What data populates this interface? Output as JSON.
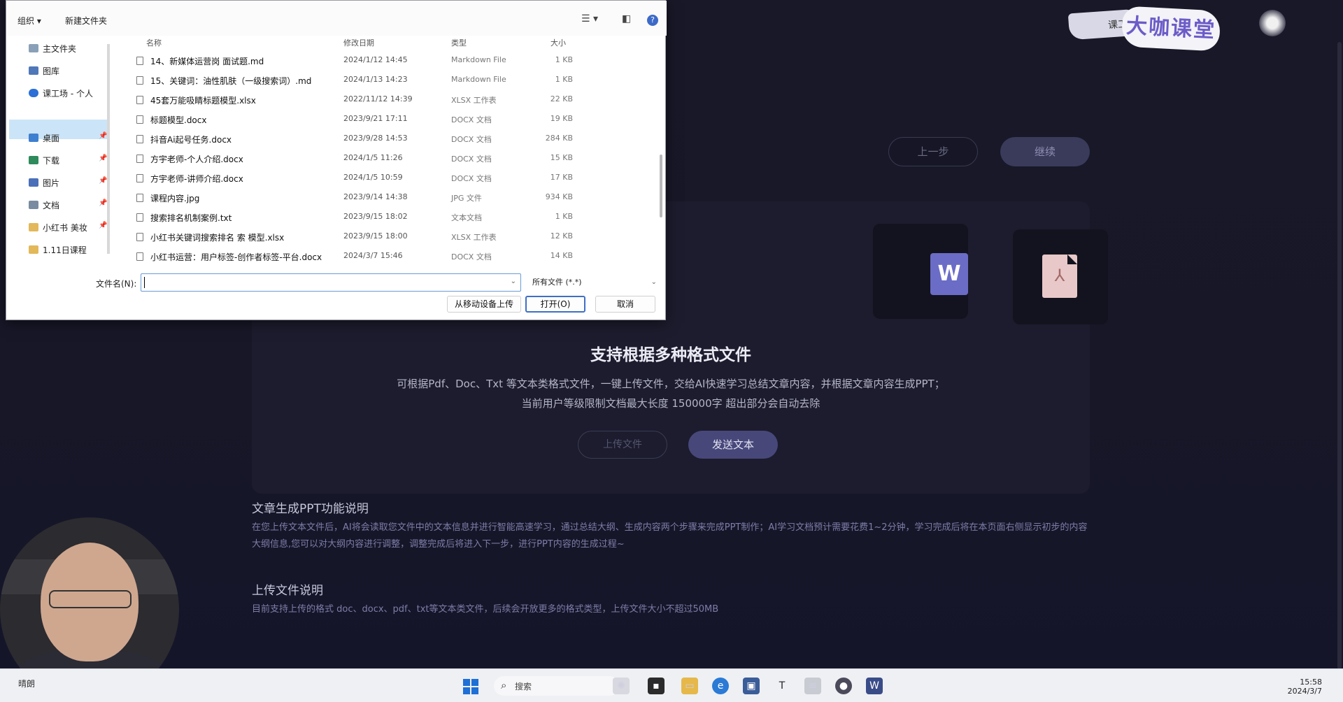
{
  "app": {
    "logo_small": "课工",
    "logo_main": "大咖课堂",
    "btn_prev": "上一步",
    "btn_next": "继续",
    "support_title": "支持根据多种格式文件",
    "support_desc_1": "可根据Pdf、Doc、Txt 等文本类格式文件，一键上传文件，交给AI快速学习总结文章内容，并根据文章内容生成PPT；",
    "support_desc_2": "当前用户等级限制文档最大长度  150000字 超出部分会自动去除",
    "btn_upload": "上传文件",
    "btn_send": "发送文本",
    "section1_title": "文章生成PPT功能说明",
    "section1_text": "在您上传文本文件后，AI将会读取您文件中的文本信息并进行智能高速学习，通过总结大纲、生成内容两个步骤来完成PPT制作；AI学习文档预计需要花费1~2分钟，学习完成后将在本页面右侧显示初步的内容大纲信息,您可以对大纲内容进行调整，调整完成后将进入下一步，进行PPT内容的生成过程~",
    "section2_title": "上传文件说明",
    "section2_text": "目前支持上传的格式 doc、docx、pdf、txt等文本类文件，后续会开放更多的格式类型，上传文件大小不超过50MB"
  },
  "dialog": {
    "toolbar": {
      "organize": "组织 ▾",
      "new_folder": "新建文件夹",
      "help": "?"
    },
    "nav": [
      {
        "label": "主文件夹",
        "pinned": false
      },
      {
        "label": "图库",
        "pinned": false
      },
      {
        "label": "课工场 - 个人",
        "pinned": false
      },
      {
        "label": "桌面",
        "pinned": true
      },
      {
        "label": "下载",
        "pinned": true
      },
      {
        "label": "图片",
        "pinned": true
      },
      {
        "label": "文档",
        "pinned": true
      },
      {
        "label": "小红书 美妆",
        "pinned": true
      },
      {
        "label": "1.11日课程",
        "pinned": false
      }
    ],
    "columns": {
      "name": "名称",
      "date": "修改日期",
      "type": "类型",
      "size": "大小"
    },
    "files": [
      {
        "name": "14、新媒体运营岗 面试题.md",
        "date": "2024/1/12 14:45",
        "type": "Markdown File",
        "size": "1 KB"
      },
      {
        "name": "15、关键词：油性肌肤（一级搜索词）.md",
        "date": "2024/1/13 14:23",
        "type": "Markdown File",
        "size": "1 KB"
      },
      {
        "name": "45套万能吸睛标题模型.xlsx",
        "date": "2022/11/12 14:39",
        "type": "XLSX 工作表",
        "size": "22 KB"
      },
      {
        "name": "标题模型.docx",
        "date": "2023/9/21 17:11",
        "type": "DOCX 文档",
        "size": "19 KB"
      },
      {
        "name": "抖音Ai起号任务.docx",
        "date": "2023/9/28 14:53",
        "type": "DOCX 文档",
        "size": "284 KB"
      },
      {
        "name": "方宇老师-个人介绍.docx",
        "date": "2024/1/5 11:26",
        "type": "DOCX 文档",
        "size": "15 KB"
      },
      {
        "name": "方宇老师-讲师介绍.docx",
        "date": "2024/1/5 10:59",
        "type": "DOCX 文档",
        "size": "17 KB"
      },
      {
        "name": "课程内容.jpg",
        "date": "2023/9/14 14:38",
        "type": "JPG 文件",
        "size": "934 KB"
      },
      {
        "name": "搜索排名机制案例.txt",
        "date": "2023/9/15 18:02",
        "type": "文本文档",
        "size": "1 KB"
      },
      {
        "name": "小红书关键词搜索排名 索 模型.xlsx",
        "date": "2023/9/15 18:00",
        "type": "XLSX 工作表",
        "size": "12 KB"
      },
      {
        "name": "小红书运营：用户标签-创作者标签-平台.docx",
        "date": "2024/3/7 15:46",
        "type": "DOCX 文档",
        "size": "14 KB"
      }
    ],
    "filename_label": "文件名(N):",
    "filename_value": "",
    "filetype": "所有文件 (*.*)",
    "btn_mobile": "从移动设备上传",
    "btn_open": "打开(O)",
    "btn_cancel": "取消"
  },
  "taskbar": {
    "search": "搜索",
    "time": "15:58",
    "date": "2024/3/7",
    "weather": "晴朗"
  }
}
